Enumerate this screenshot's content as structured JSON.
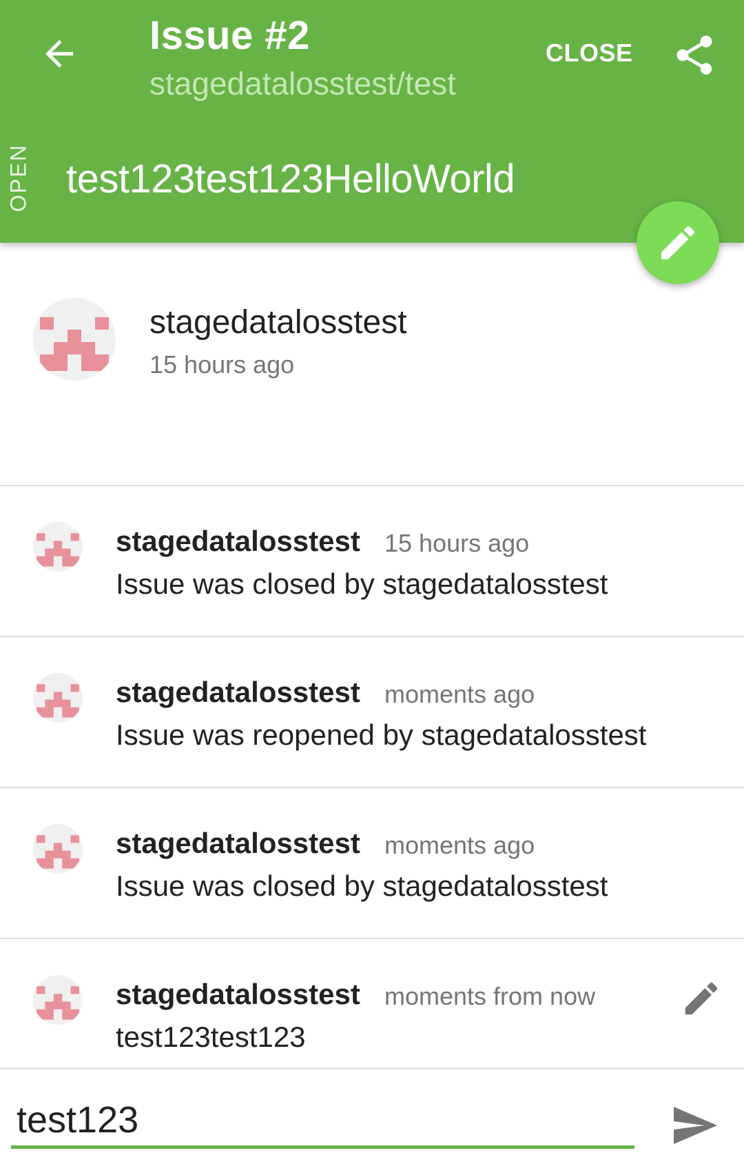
{
  "colors": {
    "primary": "#67b346",
    "fab": "#7ddb57",
    "subtitle": "#c5e6b3",
    "avatar_pink": "#e8919a",
    "secondary_text": "#757575"
  },
  "appbar": {
    "back_icon": "arrow-left-icon",
    "title": "Issue #2",
    "subtitle": "stagedatalosstest/test",
    "close_label": "CLOSE",
    "share_icon": "share-icon",
    "state": "OPEN",
    "issue_title": "test123test123HelloWorld",
    "fab_icon": "pencil-icon"
  },
  "issue": {
    "author": "stagedatalosstest",
    "time": "15 hours ago"
  },
  "events": [
    {
      "user": "stagedatalosstest",
      "time": "15 hours ago",
      "body": "Issue was closed by stagedatalosstest"
    },
    {
      "user": "stagedatalosstest",
      "time": "moments ago",
      "body": "Issue was reopened by stagedatalosstest"
    },
    {
      "user": "stagedatalosstest",
      "time": "moments ago",
      "body": "Issue was closed by stagedatalosstest"
    },
    {
      "user": "stagedatalosstest",
      "time": "moments from now",
      "body": "test123test123",
      "edit_icon": "pencil-icon"
    }
  ],
  "composer": {
    "value": "test123",
    "send_icon": "send-icon"
  }
}
